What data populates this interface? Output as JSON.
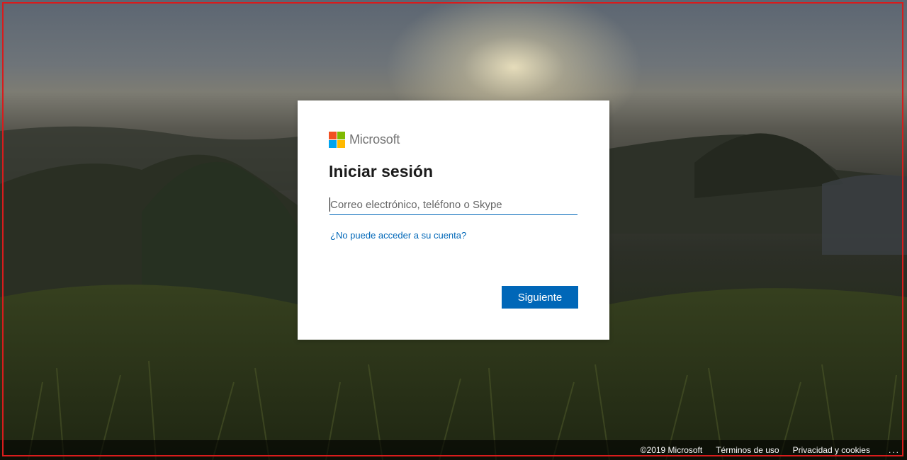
{
  "brand": {
    "name": "Microsoft",
    "logo_colors": [
      "#f25022",
      "#7fba00",
      "#00a4ef",
      "#ffb900"
    ]
  },
  "signin": {
    "title": "Iniciar sesión",
    "email_placeholder": "Correo electrónico, teléfono o Skype",
    "email_value": "",
    "help_link": "¿No puede acceder a su cuenta?",
    "next_button": "Siguiente"
  },
  "footer": {
    "copyright": "©2019 Microsoft",
    "terms": "Términos de uso",
    "privacy": "Privacidad y cookies",
    "more": "..."
  },
  "colors": {
    "accent": "#0067b8",
    "frame_border": "#d81c1c"
  },
  "background": {
    "icon": "landscape-sunset-image"
  }
}
